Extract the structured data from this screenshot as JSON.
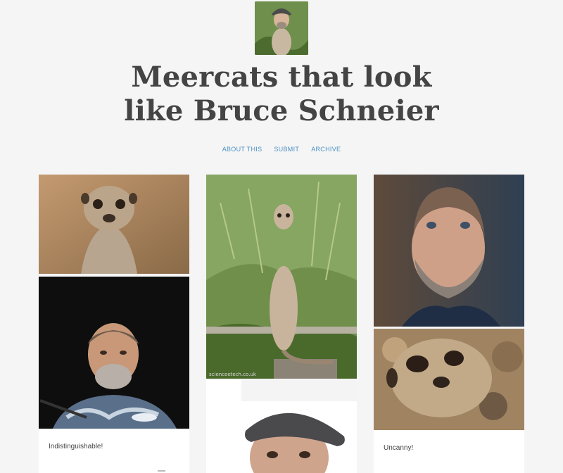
{
  "blog": {
    "title_line1": "Meercats that look",
    "title_line2": "like Bruce Schneier"
  },
  "nav": {
    "items": [
      {
        "label": "ABOUT THIS"
      },
      {
        "label": "SUBMIT"
      },
      {
        "label": "ARCHIVE"
      }
    ]
  },
  "posts": [
    {
      "caption": "Indistinguishable!"
    },
    {
      "caption": "Uncanny!"
    }
  ],
  "watermarks": {
    "photo_credit": "scienceetech.co.uk"
  },
  "colors": {
    "background": "#f5f5f5",
    "title": "#444444",
    "link": "#4a90c4"
  }
}
